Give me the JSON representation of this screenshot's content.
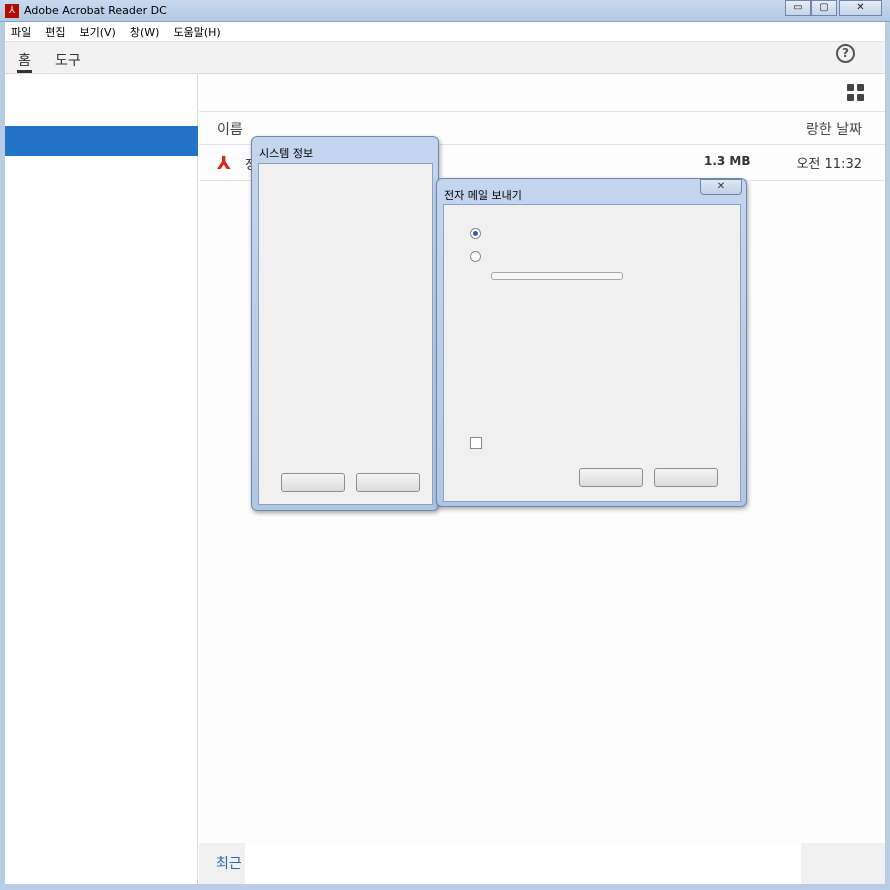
{
  "window": {
    "title": "Adobe Acrobat Reader DC",
    "app_icon": "pdf-logo-icon",
    "minimize_glyph": "▭",
    "maximize_glyph": "▢",
    "close_glyph": "✕"
  },
  "menubar": {
    "items": [
      "파일",
      "편집",
      "보기(V)",
      "창(W)",
      "도움말(H)"
    ]
  },
  "tabs": {
    "home": "홈",
    "tools": "도구",
    "help_glyph": "?"
  },
  "content": {
    "col_name": "이름",
    "col_date": "랑한 날짜",
    "file": {
      "name_partial": "정",
      "size": "1.3 MB",
      "time": "오전 11:32"
    },
    "bottom_label": "최근"
  },
  "dialog_sysinfo": {
    "title": "시스템 정보"
  },
  "dialog_email": {
    "title": "전자 메일 보내기",
    "close_glyph": "✕",
    "radio_option1_selected": true,
    "radio_option2_selected": false,
    "checkbox_checked": false
  }
}
